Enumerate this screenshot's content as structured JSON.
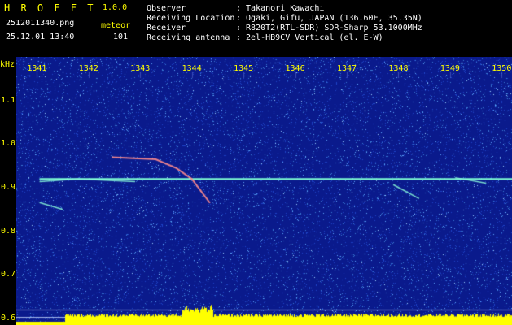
{
  "app": {
    "name": "H R O F F T",
    "version": "1.0.0"
  },
  "file": {
    "name": "2512011340.png",
    "datetime": "25.12.01 13:40"
  },
  "stats": {
    "type_label": "meteor",
    "count": "101"
  },
  "info": [
    {
      "label": "Observer",
      "value": ": Takanori Kawachi"
    },
    {
      "label": "Receiving Location",
      "value": ": Ogaki, Gifu, JAPAN (136.60E, 35.35N)"
    },
    {
      "label": "Receiver",
      "value": ": R820T2(RTL-SDR) SDR-Sharp 53.1000MHz"
    },
    {
      "label": "Receiving antenna",
      "value": ": 2el-HB9CV Vertical (el. E-W)"
    }
  ],
  "colors": {
    "text_yellow": "#ffff00",
    "text_white": "#ffffff",
    "background": "#0a1a8c",
    "noise": "#3a7bd5",
    "carrier": "#7fffd4"
  },
  "chart_data": {
    "type": "heatmap",
    "ylabel": "kHz",
    "x_ticks": [
      "1341",
      "1342",
      "1343",
      "1344",
      "1345",
      "1346",
      "1347",
      "1348",
      "1349",
      "1350"
    ],
    "y_ticks": [
      "1.1",
      "1.0",
      "0.9",
      "0.8",
      "0.7",
      "0.6"
    ],
    "xlim": [
      1340.6,
      1350.2
    ],
    "ylim": [
      0.585,
      1.2
    ],
    "carrier_khz": 0.92,
    "echoes": [
      {
        "t": [
          1342.45,
          1343.3,
          1343.7,
          1344.0,
          1344.35
        ],
        "f": [
          0.97,
          0.965,
          0.945,
          0.92,
          0.865
        ]
      },
      {
        "t": [
          1341.05,
          1341.8,
          1342.9
        ],
        "f": [
          0.914,
          0.92,
          0.914
        ]
      },
      {
        "t": [
          1341.05,
          1341.5
        ],
        "f": [
          0.866,
          0.85
        ]
      },
      {
        "t": [
          1347.9,
          1348.4
        ],
        "f": [
          0.907,
          0.875
        ]
      },
      {
        "t": [
          1349.1,
          1349.7
        ],
        "f": [
          0.923,
          0.91
        ]
      }
    ]
  }
}
